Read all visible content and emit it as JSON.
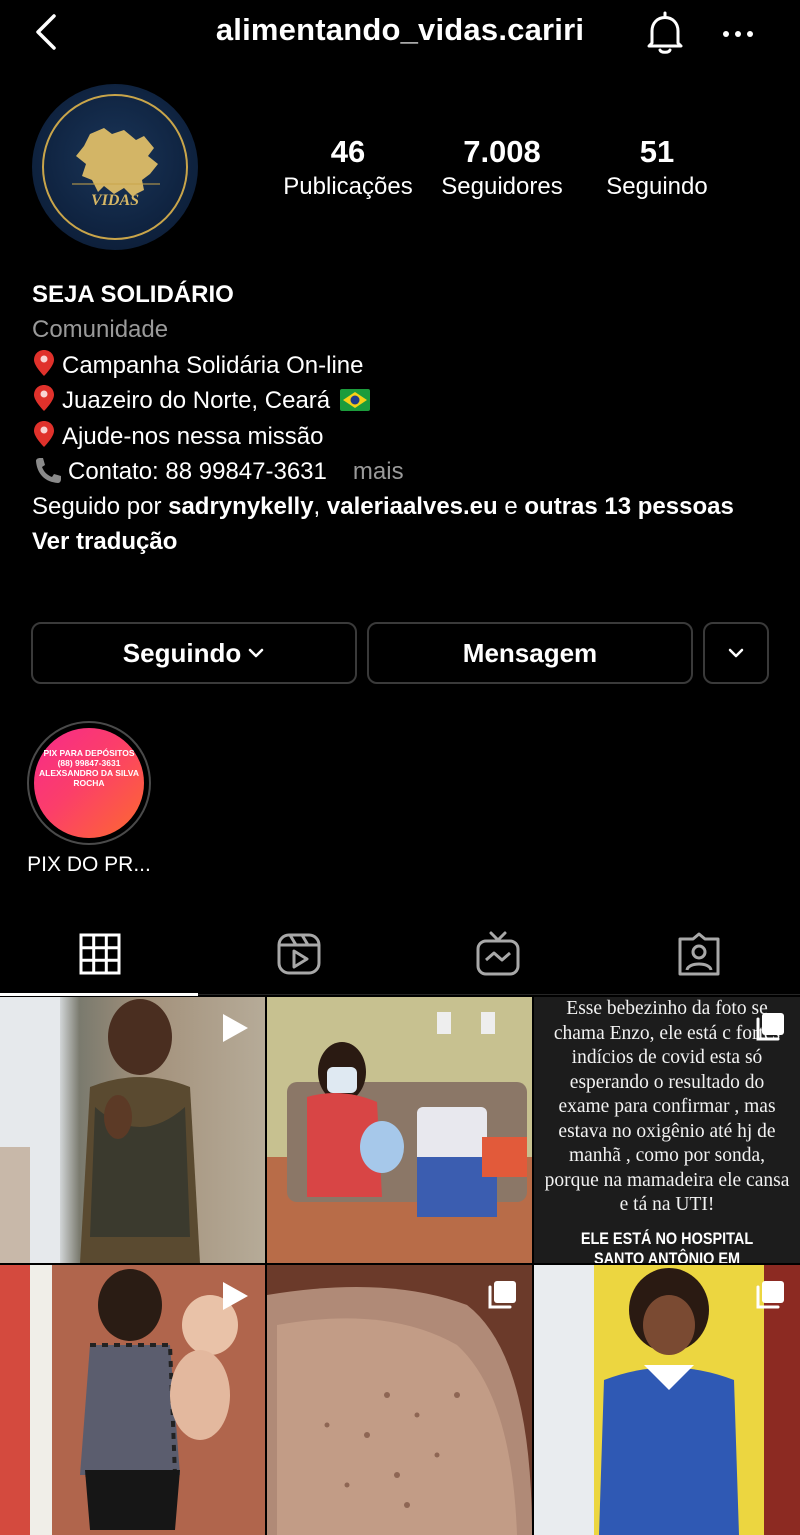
{
  "header": {
    "username": "alimentando_vidas.cariri",
    "back_icon": "chevron-left-icon",
    "notification_icon": "bell-icon",
    "more_icon": "more-horizontal-icon"
  },
  "profile": {
    "avatar_text": "VIDAS",
    "stats": [
      {
        "value": "46",
        "label": "Publicações"
      },
      {
        "value": "7.008",
        "label": "Seguidores"
      },
      {
        "value": "51",
        "label": "Seguindo"
      }
    ]
  },
  "bio": {
    "name": "SEJA SOLIDÁRIO",
    "category": "Comunidade",
    "line1": "Campanha Solidária On-line",
    "line2": "Juazeiro do Norte, Ceará",
    "line3": "Ajude-nos nessa missão",
    "line4": "Contato: 88 99847-3631",
    "more": "mais",
    "followed_prefix": "Seguido por ",
    "followed_user1": "sadrynykelly",
    "followed_sep": ", ",
    "followed_user2": "valeriaalves.eu",
    "followed_and": " e ",
    "followed_others": "outras 13 pessoas",
    "translate": "Ver tradução"
  },
  "actions": {
    "following_label": "Seguindo",
    "message_label": "Mensagem"
  },
  "highlight": {
    "line1": "PIX PARA DEPÓSITOS",
    "line2": "(88) 99847-3631",
    "line3": "ALEXSANDRO DA SILVA ROCHA",
    "label": "PIX DO PR..."
  },
  "tabs": [
    "grid-icon",
    "reels-icon",
    "igtv-icon",
    "tagged-icon"
  ],
  "posts": {
    "enzo_caption": "Esse bebezinho da foto se chama Enzo, ele está c fortes indícios de covid esta só esperando o resultado do exame para confirmar , mas estava no oxigênio até hj de manhã , como por sonda, porque na mamadeira ele cansa e tá na UTI!",
    "enzo_hospital": "ELE ESTÁ NO HOSPITAL SANTO ANTÔNIO EM BARBALA, ELE PRECISA"
  },
  "colors": {
    "background": "#000000",
    "muted_text": "#9a9a9a",
    "button_border": "#3a3a3a",
    "highlight_gradient": [
      "#f72a8a",
      "#fd6a2e"
    ]
  }
}
